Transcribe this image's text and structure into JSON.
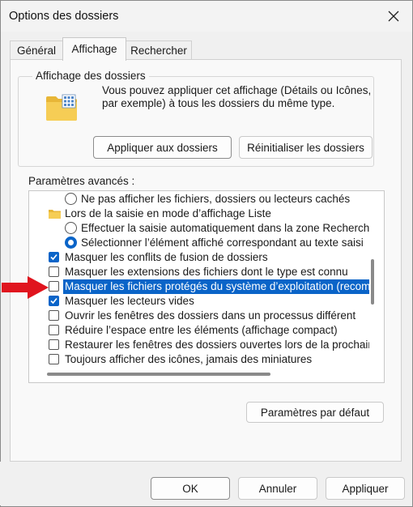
{
  "window": {
    "title": "Options des dossiers"
  },
  "tabs": [
    {
      "label": "Général"
    },
    {
      "label": "Affichage"
    },
    {
      "label": "Rechercher"
    }
  ],
  "folder_view": {
    "legend": "Affichage des dossiers",
    "description": "Vous pouvez appliquer cet affichage (Détails ou Icônes, par exemple) à tous les dossiers du même type.",
    "apply_button": "Appliquer aux dossiers",
    "reset_button": "Réinitialiser les dossiers"
  },
  "advanced": {
    "label": "Paramètres avancés :",
    "items": [
      {
        "type": "radio",
        "checked": false,
        "indent": 1,
        "text": "Ne pas afficher les fichiers, dossiers ou lecteurs cachés"
      },
      {
        "type": "folder",
        "indent": 0,
        "text": "Lors de la saisie en mode d’affichage Liste"
      },
      {
        "type": "radio",
        "checked": false,
        "indent": 1,
        "text": "Effectuer la saisie automatiquement dans la zone Recherche"
      },
      {
        "type": "radio",
        "checked": true,
        "indent": 1,
        "text": "Sélectionner l’élément affiché correspondant au texte saisi"
      },
      {
        "type": "checkbox",
        "checked": true,
        "indent": 0,
        "text": "Masquer les conflits de fusion de dossiers"
      },
      {
        "type": "checkbox",
        "checked": false,
        "indent": 0,
        "text": "Masquer les extensions des fichiers dont le type est connu"
      },
      {
        "type": "checkbox",
        "checked": false,
        "indent": 0,
        "selected": true,
        "text": "Masquer les fichiers protégés du système d’exploitation (recommandé)"
      },
      {
        "type": "checkbox",
        "checked": true,
        "indent": 0,
        "text": "Masquer les lecteurs vides"
      },
      {
        "type": "checkbox",
        "checked": false,
        "indent": 0,
        "text": "Ouvrir les fenêtres des dossiers dans un processus différent"
      },
      {
        "type": "checkbox",
        "checked": false,
        "indent": 0,
        "text": "Réduire l’espace entre les éléments (affichage compact)"
      },
      {
        "type": "checkbox",
        "checked": false,
        "indent": 0,
        "text": "Restaurer les fenêtres des dossiers ouvertes lors de la prochaine ouverture de session"
      },
      {
        "type": "checkbox",
        "checked": false,
        "indent": 0,
        "text": "Toujours afficher des icônes, jamais des miniatures"
      }
    ],
    "defaults_button": "Paramètres par défaut"
  },
  "footer": {
    "ok": "OK",
    "cancel": "Annuler",
    "apply": "Appliquer"
  },
  "colors": {
    "accent": "#0a64c8",
    "arrow": "#e0141e"
  }
}
